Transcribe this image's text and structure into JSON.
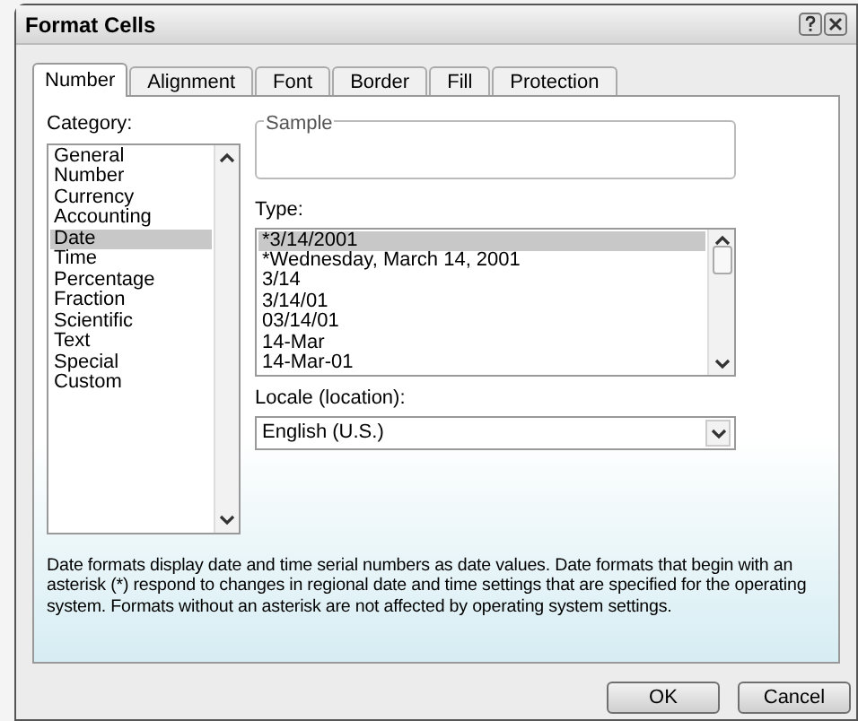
{
  "window": {
    "title": "Format Cells"
  },
  "tabs": [
    {
      "label": "Number",
      "selected": true
    },
    {
      "label": "Alignment",
      "selected": false
    },
    {
      "label": "Font",
      "selected": false
    },
    {
      "label": "Border",
      "selected": false
    },
    {
      "label": "Fill",
      "selected": false
    },
    {
      "label": "Protection",
      "selected": false
    }
  ],
  "category": {
    "label": "Category:",
    "items": [
      {
        "label": "General",
        "selected": false
      },
      {
        "label": "Number",
        "selected": false
      },
      {
        "label": "Currency",
        "selected": false
      },
      {
        "label": "Accounting",
        "selected": false
      },
      {
        "label": "Date",
        "selected": true
      },
      {
        "label": "Time",
        "selected": false
      },
      {
        "label": "Percentage",
        "selected": false
      },
      {
        "label": "Fraction",
        "selected": false
      },
      {
        "label": "Scientific",
        "selected": false
      },
      {
        "label": "Text",
        "selected": false
      },
      {
        "label": "Special",
        "selected": false
      },
      {
        "label": "Custom",
        "selected": false
      }
    ]
  },
  "sample": {
    "label": "Sample"
  },
  "type": {
    "label": "Type:",
    "items": [
      {
        "label": "*3/14/2001",
        "selected": true
      },
      {
        "label": "*Wednesday, March 14, 2001",
        "selected": false
      },
      {
        "label": "3/14",
        "selected": false
      },
      {
        "label": "3/14/01",
        "selected": false
      },
      {
        "label": "03/14/01",
        "selected": false
      },
      {
        "label": "14-Mar",
        "selected": false
      },
      {
        "label": "14-Mar-01",
        "selected": false
      }
    ]
  },
  "locale": {
    "label": "Locale (location):",
    "value": "English (U.S.)"
  },
  "description": "Date formats display date and time serial numbers as date values.  Date formats that begin with an asterisk (*) respond to changes in regional date and time settings that are specified for the operating system. Formats without an asterisk are not affected by operating system settings.",
  "buttons": [
    "OK",
    "Cancel"
  ]
}
